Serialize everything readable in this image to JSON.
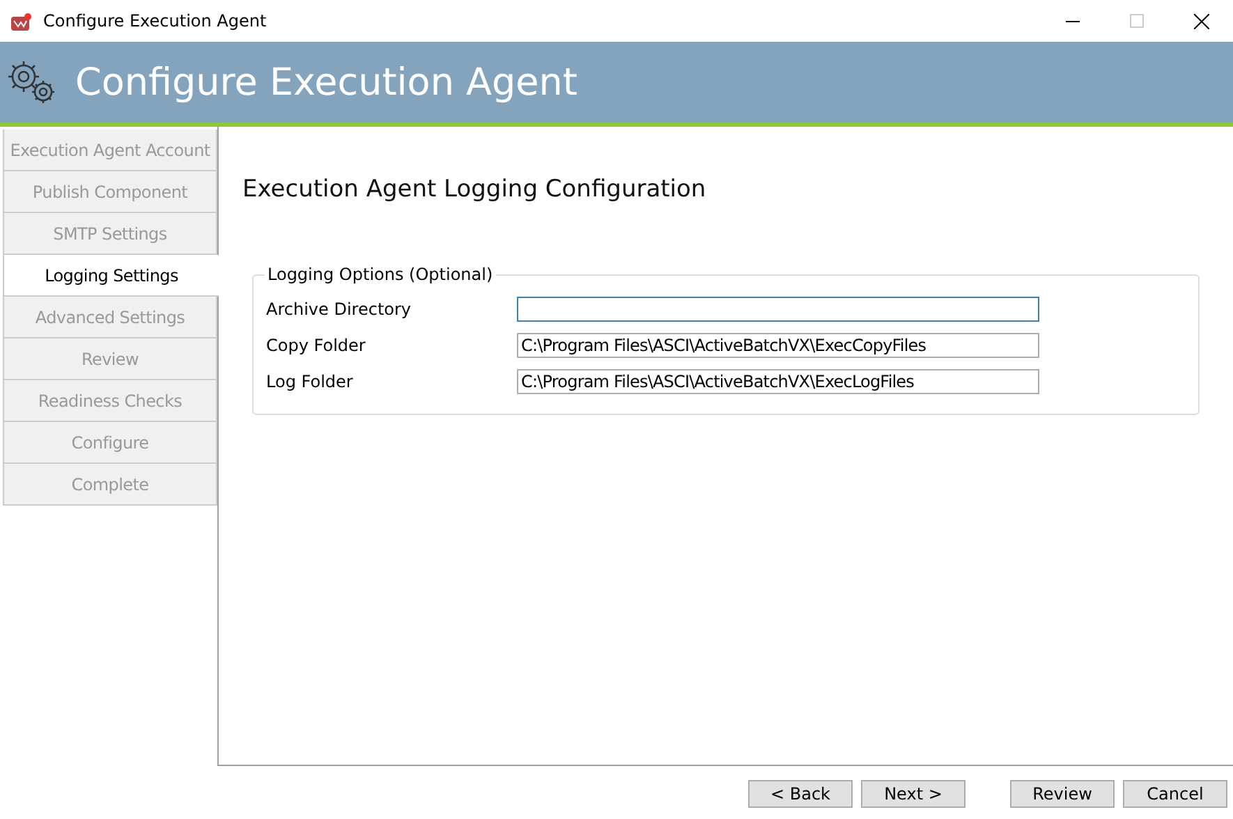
{
  "window": {
    "title": "Configure Execution Agent"
  },
  "header": {
    "title": "Configure Execution Agent"
  },
  "sidebar": {
    "items": [
      {
        "label": "Execution Agent Account",
        "selected": false
      },
      {
        "label": "Publish Component",
        "selected": false
      },
      {
        "label": "SMTP Settings",
        "selected": false
      },
      {
        "label": "Logging Settings",
        "selected": true
      },
      {
        "label": "Advanced Settings",
        "selected": false
      },
      {
        "label": "Review",
        "selected": false
      },
      {
        "label": "Readiness Checks",
        "selected": false
      },
      {
        "label": "Configure",
        "selected": false
      },
      {
        "label": "Complete",
        "selected": false
      }
    ]
  },
  "page": {
    "title": "Execution Agent Logging Configuration",
    "group": {
      "title": "Logging Options (Optional)",
      "fields": [
        {
          "label": "Archive Directory",
          "focused": true
        },
        {
          "label": "Copy Folder",
          "value": "C:\\Program Files\\ASCI\\ActiveBatchVX\\ExecCopyFiles",
          "focused": false
        },
        {
          "label": "Log Folder",
          "value": "C:\\Program Files\\ASCI\\ActiveBatchVX\\ExecLogFiles",
          "focused": false
        }
      ]
    }
  },
  "footer": {
    "nav_buttons": [
      "< Back",
      "Next >"
    ],
    "end_buttons": [
      "Review",
      "Cancel"
    ]
  }
}
